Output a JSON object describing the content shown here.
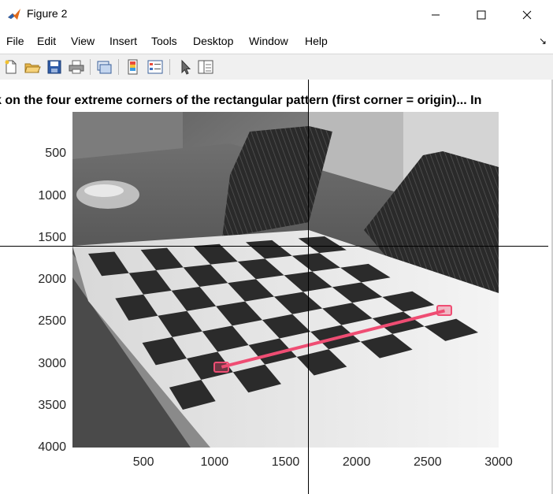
{
  "window": {
    "title": "Figure 2",
    "minimize_glyph": "—",
    "maximize_glyph": "☐",
    "close_glyph": "✕"
  },
  "menu": {
    "items": [
      "File",
      "Edit",
      "View",
      "Insert",
      "Tools",
      "Desktop",
      "Window",
      "Help"
    ],
    "dock_arrow": "↘"
  },
  "toolbar": {
    "buttons": [
      "new-figure-icon",
      "open-file-icon",
      "save-icon",
      "print-icon",
      "link-plot-icon",
      "colorbar-icon",
      "legend-icon",
      "edit-plot-arrow-icon",
      "property-inspector-icon"
    ]
  },
  "figure": {
    "title": "k on the four extreme corners of the rectangular pattern (first corner = origin)... In",
    "yticks": [
      "500",
      "1000",
      "1500",
      "2000",
      "2500",
      "3000",
      "3500",
      "4000"
    ],
    "xticks": [
      "500",
      "1000",
      "1500",
      "2000",
      "2500",
      "3000"
    ],
    "crosshair": {
      "x": 1660,
      "y": 1600
    },
    "points": [
      {
        "x": 1050,
        "y": 3040
      },
      {
        "x": 2620,
        "y": 2370
      }
    ],
    "line_color": "#ef4d73",
    "image_domain": {
      "x": [
        0,
        3000
      ],
      "y": [
        0,
        4000
      ]
    }
  }
}
